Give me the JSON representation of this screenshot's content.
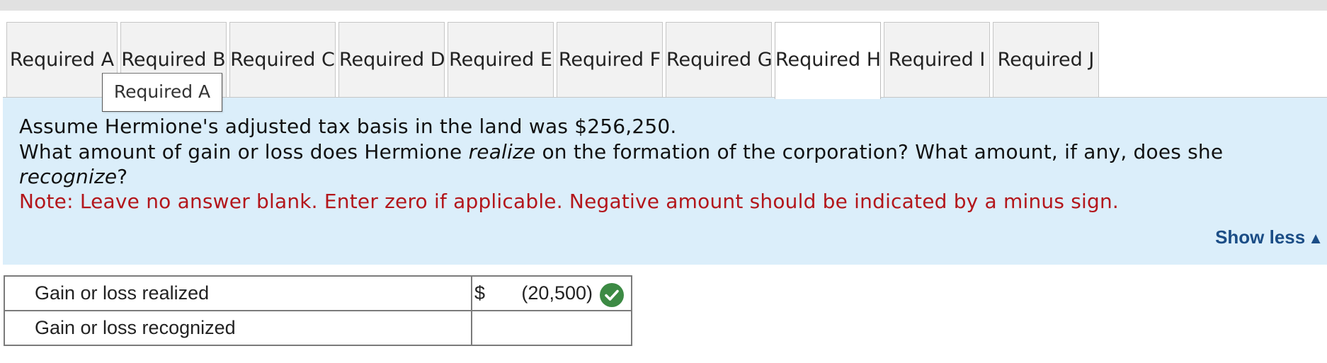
{
  "tabs": [
    {
      "label": "Required A",
      "active": false
    },
    {
      "label": "Required B",
      "active": false
    },
    {
      "label": "Required C",
      "active": false
    },
    {
      "label": "Required D",
      "active": false
    },
    {
      "label": "Required E",
      "active": false
    },
    {
      "label": "Required F",
      "active": false
    },
    {
      "label": "Required G",
      "active": false
    },
    {
      "label": "Required H",
      "active": true
    },
    {
      "label": "Required I",
      "active": false
    },
    {
      "label": "Required J",
      "active": false
    }
  ],
  "tooltip": {
    "text": "Required A"
  },
  "prompt": {
    "line1": "Assume Hermione's adjusted tax basis in the land was $256,250.",
    "line2_a": "What amount of gain or loss does Hermione ",
    "line2_realize": "realize",
    "line2_b": " on the formation of the corporation? What amount, if any, does she",
    "line3_recognize": "recognize",
    "line3_q": "?",
    "note": "Note: Leave no answer blank. Enter zero if applicable. Negative amount should be indicated by a minus sign.",
    "show_less": "Show less",
    "show_less_icon": "triangle-up-icon"
  },
  "answers": {
    "rows": [
      {
        "label": "Gain or loss realized",
        "currency": "$",
        "value": "(20,500)",
        "status": "correct"
      },
      {
        "label": "Gain or loss recognized",
        "currency": "",
        "value": "",
        "status": ""
      }
    ]
  },
  "colors": {
    "prompt_bg": "#dbeefa",
    "note_text": "#b3161b",
    "link": "#1b4d86",
    "check_green": "#3c8a44"
  }
}
